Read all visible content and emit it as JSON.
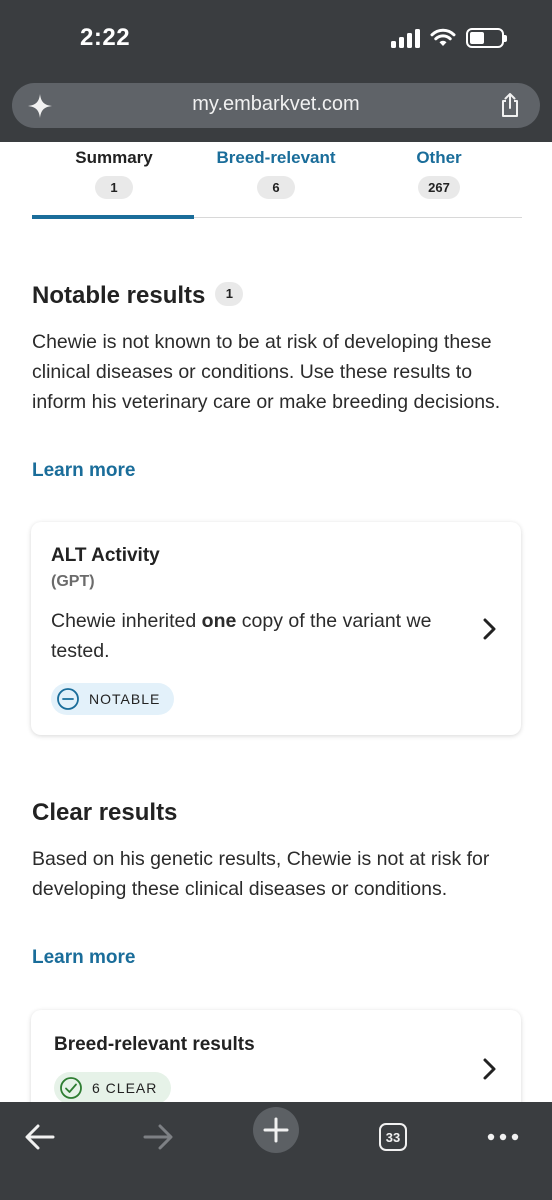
{
  "status_bar": {
    "time": "2:22"
  },
  "browser": {
    "url": "my.embarkvet.com",
    "open_tabs": "33"
  },
  "tabs": [
    {
      "label": "Summary",
      "count": "1",
      "active": true
    },
    {
      "label": "Breed-relevant",
      "count": "6",
      "active": false
    },
    {
      "label": "Other",
      "count": "267",
      "active": false
    }
  ],
  "notable": {
    "title": "Notable results",
    "badge": "1",
    "description": "Chewie is not known to be at risk of developing these clinical diseases or conditions. Use these results to inform his veterinary care or make breeding decisions.",
    "learn_more": "Learn more",
    "card": {
      "title": "ALT Activity",
      "subtitle": "(GPT)",
      "desc_before": "Chewie inherited ",
      "desc_bold": "one",
      "desc_after": " copy of the variant we tested.",
      "status": "NOTABLE"
    }
  },
  "clear": {
    "title": "Clear results",
    "description": "Based on his genetic results, Chewie is not at risk for developing these clinical diseases or conditions.",
    "learn_more": "Learn more",
    "card": {
      "title": "Breed-relevant results",
      "status": "6 CLEAR"
    }
  },
  "colors": {
    "accent": "#1a6d9a",
    "chrome": "#3a3d40",
    "notable_pill": "#e3f1fa",
    "clear_pill": "#e6f2e8",
    "clear_icon": "#2e7d32"
  }
}
